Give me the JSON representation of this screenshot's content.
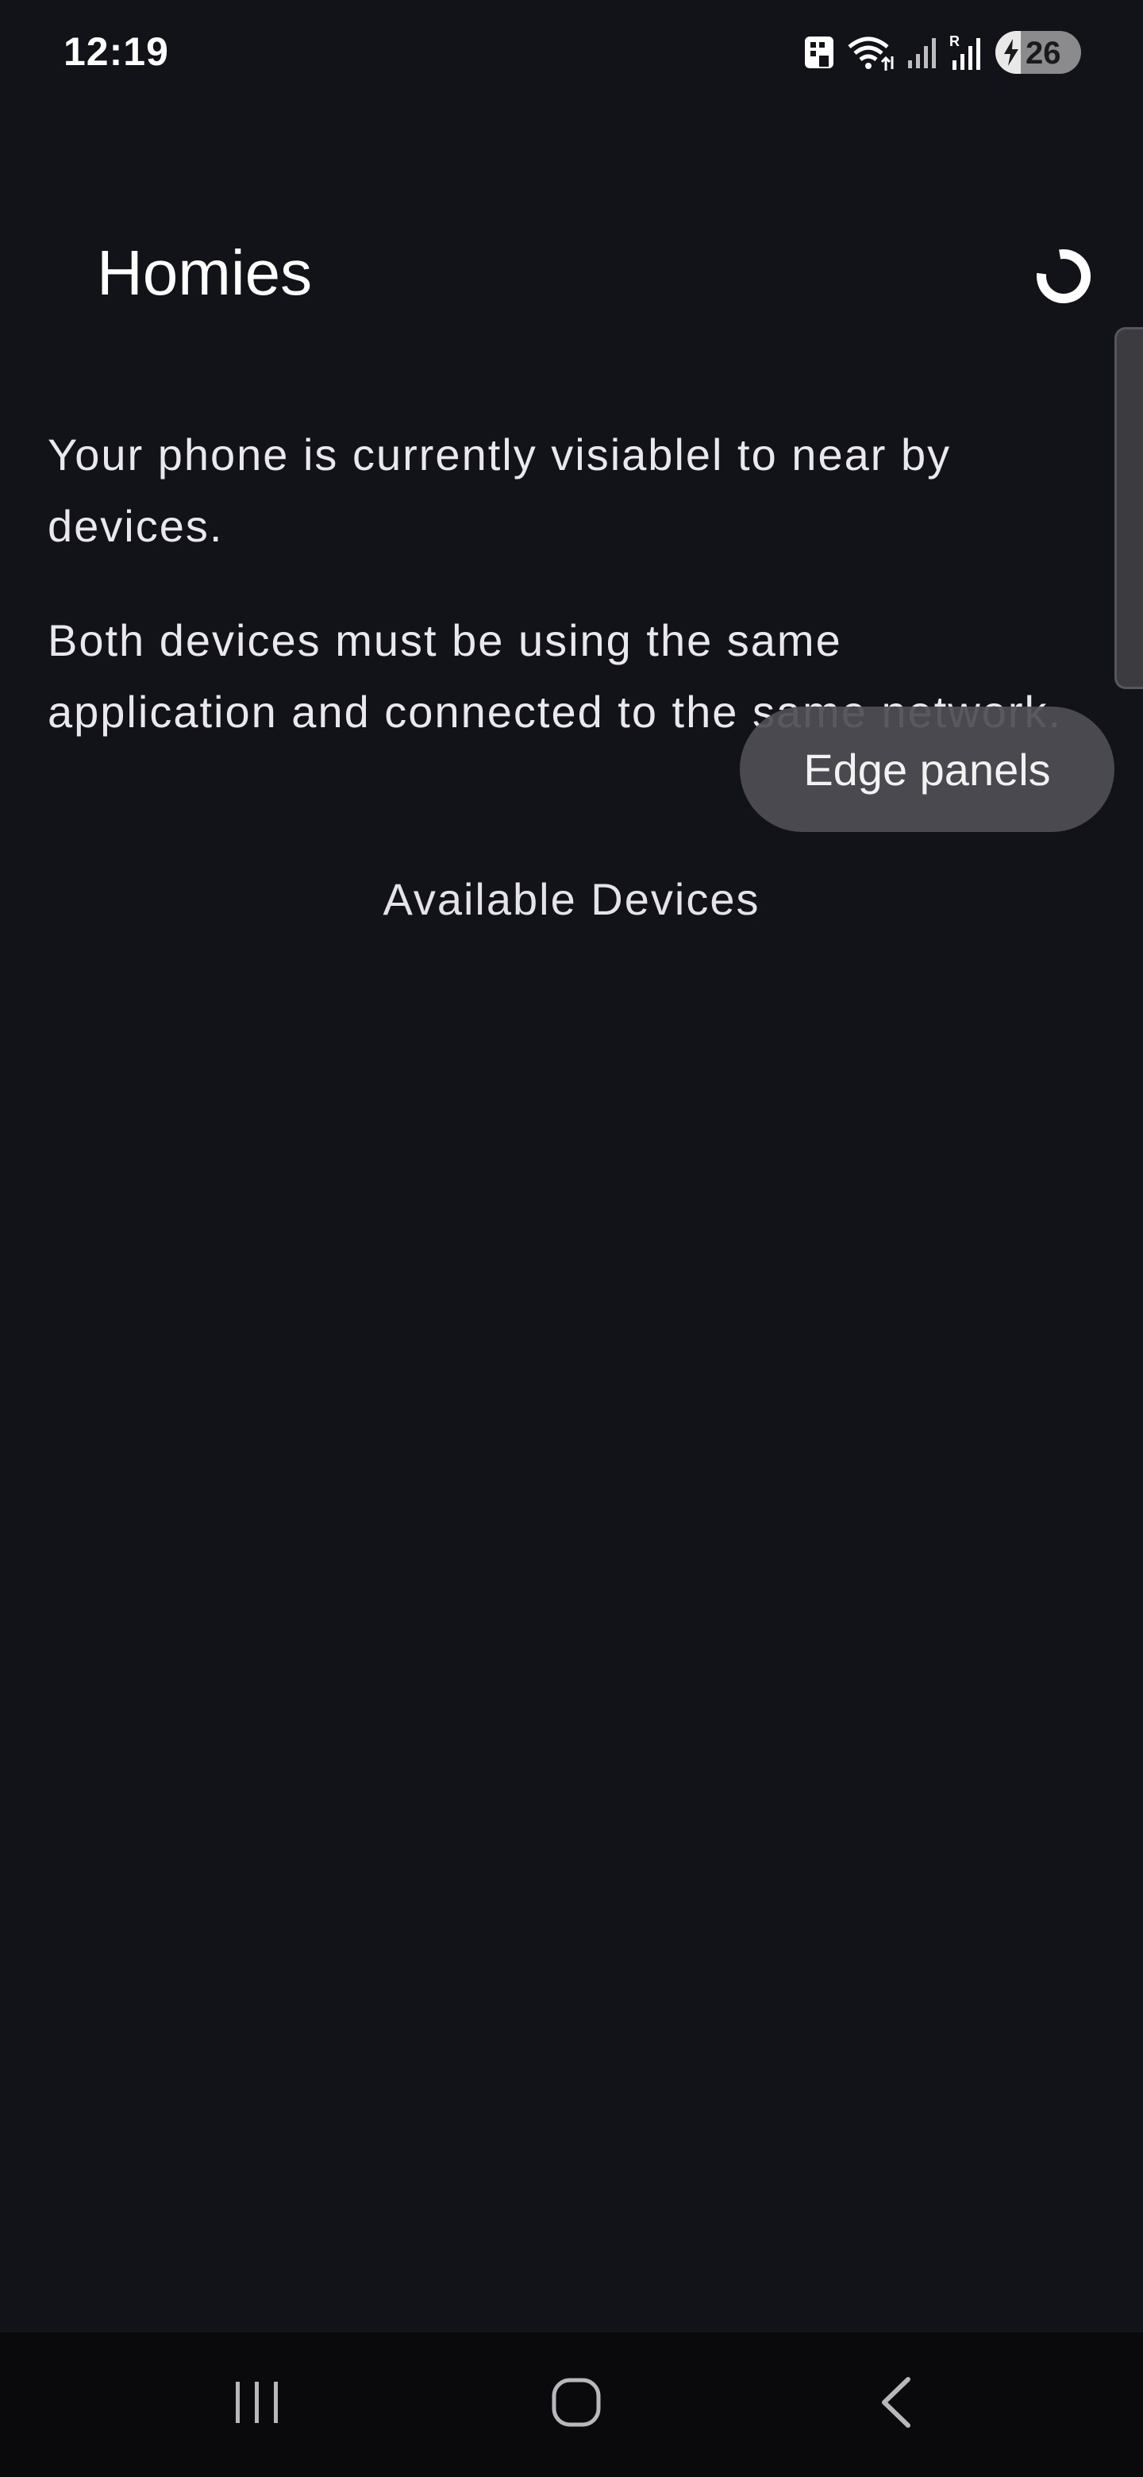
{
  "status_bar": {
    "time": "12:19",
    "battery_level": "26",
    "icons": [
      "notification-app-icon",
      "wifi-icon",
      "signal-icon",
      "signal-roaming-icon",
      "battery-charging-icon"
    ]
  },
  "app_bar": {
    "title": "Homies",
    "refresh_icon": "refresh-icon"
  },
  "content": {
    "visibility_message": "Your phone is currently visiablel to near by devices.",
    "requirement_message": "Both devices must be using the same application and connected to the same network.",
    "devices_heading": "Available Devices",
    "devices": []
  },
  "toast": {
    "text": "Edge panels"
  },
  "nav_bar": {
    "icons": [
      "recents-icon",
      "home-icon",
      "back-icon"
    ]
  },
  "colors": {
    "background": "#121318",
    "text": "#e4e3ea",
    "toast": "#4e4e54",
    "nav_bar": "#0a0a0c"
  }
}
